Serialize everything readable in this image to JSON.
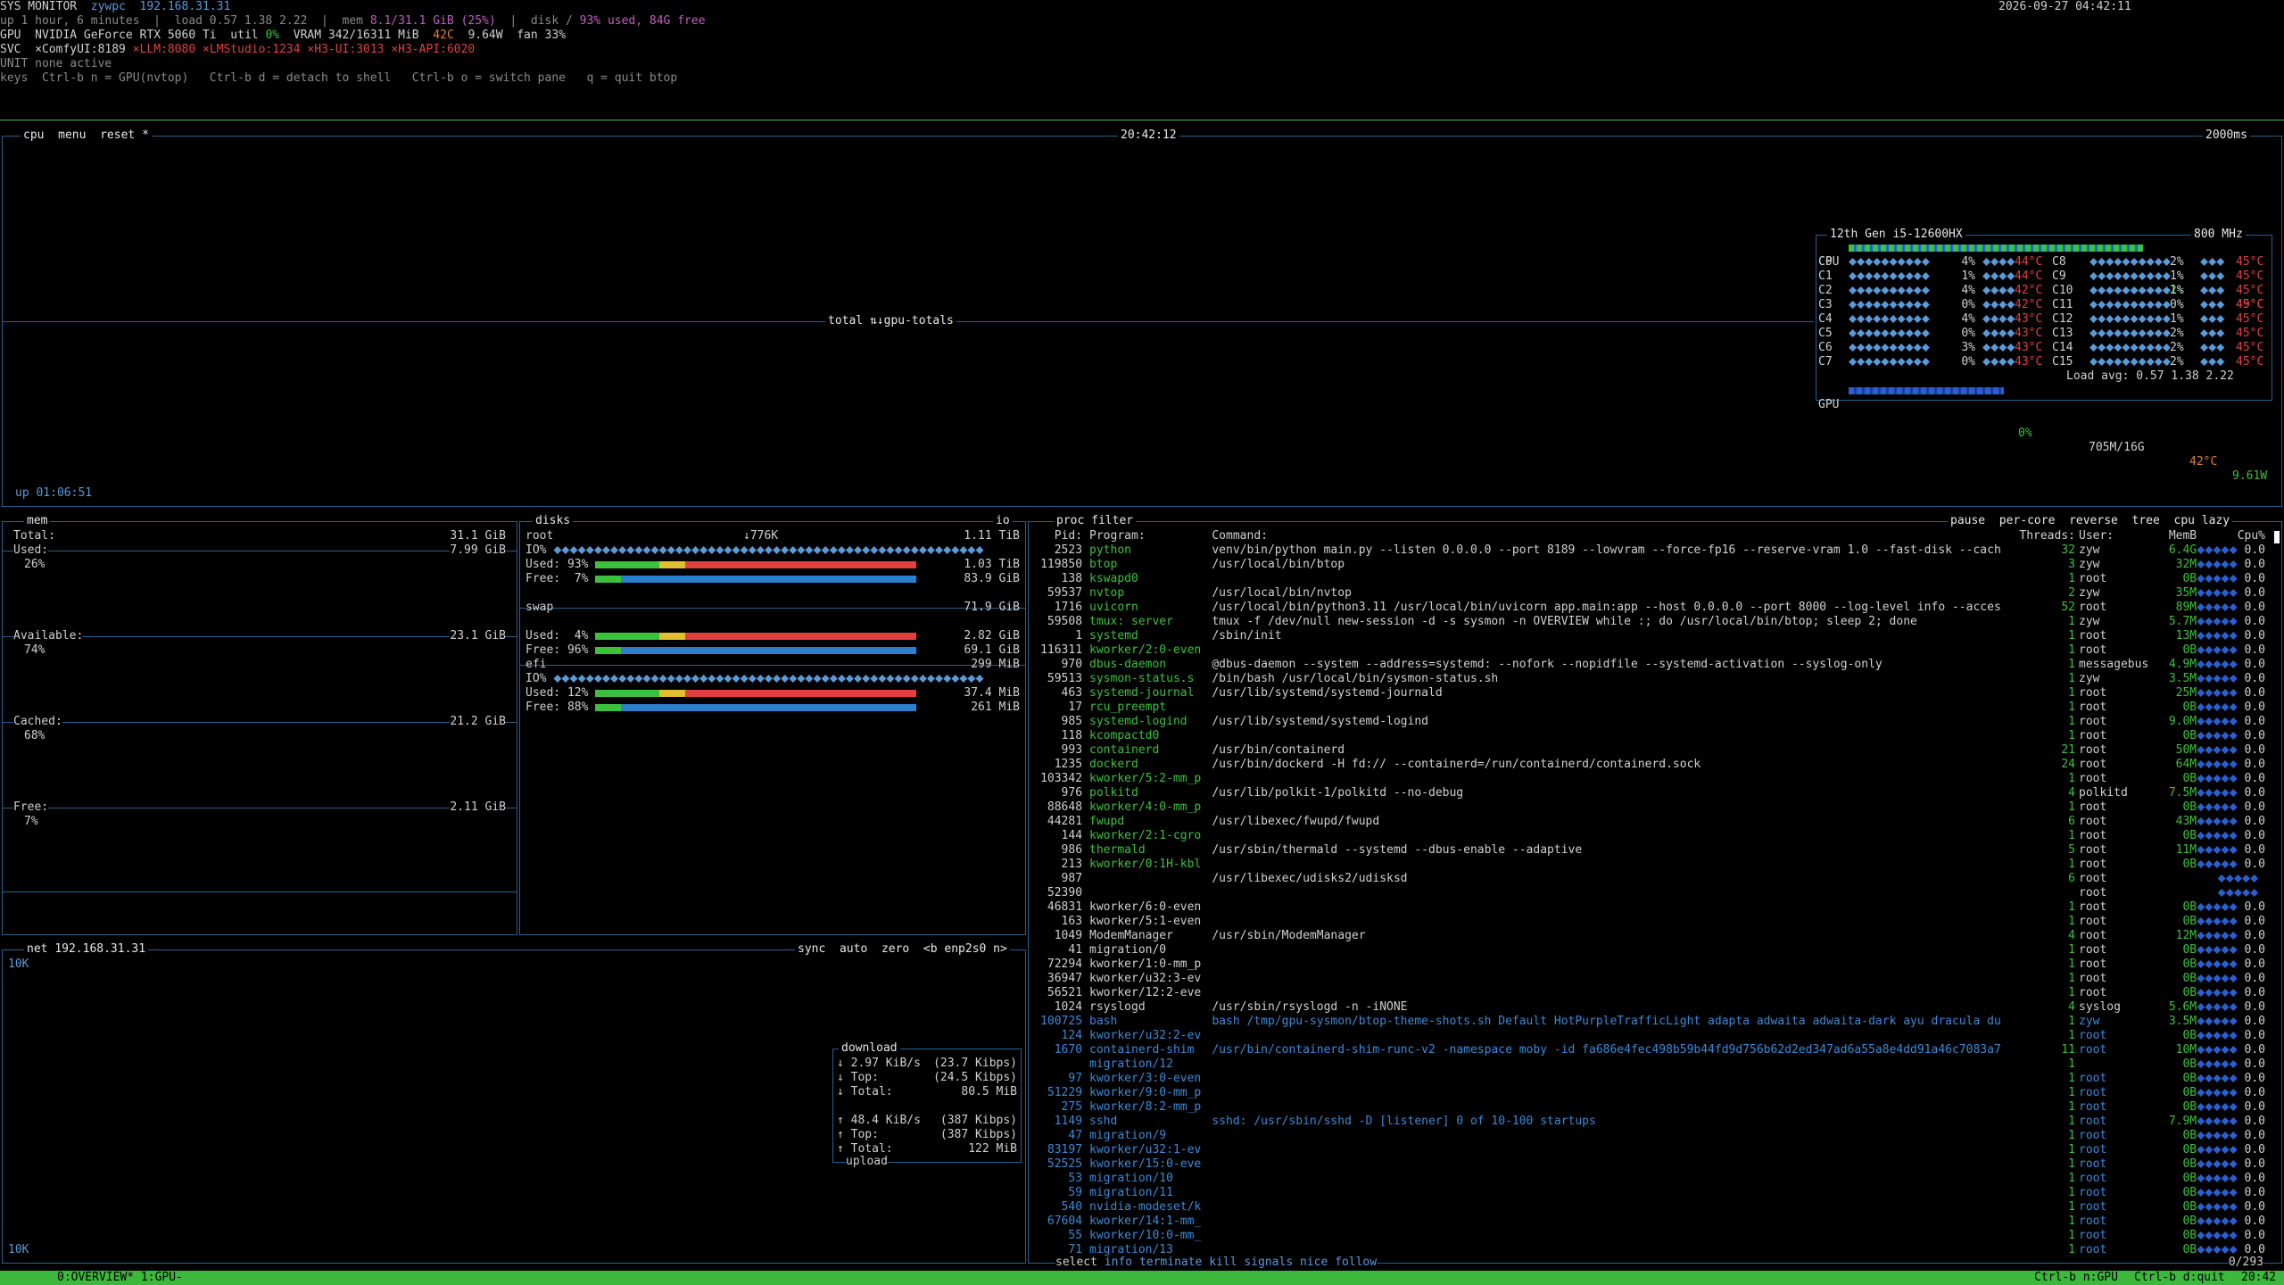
{
  "header": {
    "title": "SYS MONITOR",
    "host": "zywpc",
    "ip": "192.168.31.31",
    "datetime": "2026-09-27 04:42:11",
    "line_up": "up 1 hour, 6 minutes  |  load 0.57 1.38 2.22  |  mem ",
    "mem_val": "8.1/31.1 GiB (25%)",
    "line_mid": "  |  disk / ",
    "disk_val": "93% used, 84G free",
    "gpu_label": "GPU",
    "gpu_name": "NVIDIA GeForce RTX 5060 Ti",
    "gpu_util_label": "util",
    "gpu_util": "0%",
    "gpu_vram_label": "VRAM",
    "gpu_vram": "342/16311 MiB",
    "gpu_temp": "42C",
    "gpu_power": "9.64W",
    "gpu_fan": "fan 33%",
    "svc_label": "SVC",
    "services": [
      "×ComfyUI:8189",
      "×LLM:8080",
      "×LMStudio:1234",
      "×H3-UI:3013",
      "×H3-API:6020"
    ],
    "unit_label": "UNIT",
    "unit_val": "none active",
    "keys_label": "keys",
    "keys_val": "Ctrl-b n = GPU(nvtop)   Ctrl-b d = detach to shell   Ctrl-b o = switch pane   q = quit btop"
  },
  "cpu": {
    "tab1": "cpu",
    "tab2": "menu",
    "tab3": "reset *",
    "clock": "20:42:12",
    "interval": "2000ms",
    "graph_label": "total ⇅↓gpu-totals",
    "uptime": "up 01:06:51",
    "model": "12th Gen i5-12600HX",
    "freq": "800 MHz",
    "total_label": "CPU",
    "total_pct": "2%",
    "total_temp": "49°C",
    "cores": [
      {
        "a": "C0",
        "ap": "4%",
        "at": "44°C",
        "b": "C8",
        "bp": "2%",
        "bt": "45°C"
      },
      {
        "a": "C1",
        "ap": "1%",
        "at": "44°C",
        "b": "C9",
        "bp": "1%",
        "bt": "45°C"
      },
      {
        "a": "C2",
        "ap": "4%",
        "at": "42°C",
        "b": "C10",
        "bp": "1%",
        "bt": "45°C"
      },
      {
        "a": "C3",
        "ap": "0%",
        "at": "42°C",
        "b": "C11",
        "bp": "0%",
        "bt": "45°C"
      },
      {
        "a": "C4",
        "ap": "4%",
        "at": "43°C",
        "b": "C12",
        "bp": "1%",
        "bt": "45°C"
      },
      {
        "a": "C5",
        "ap": "0%",
        "at": "43°C",
        "b": "C13",
        "bp": "2%",
        "bt": "45°C"
      },
      {
        "a": "C6",
        "ap": "3%",
        "at": "43°C",
        "b": "C14",
        "bp": "2%",
        "bt": "45°C"
      },
      {
        "a": "C7",
        "ap": "0%",
        "at": "43°C",
        "b": "C15",
        "bp": "2%",
        "bt": "45°C"
      }
    ],
    "load_avg": "Load avg: 0.57 1.38 2.22",
    "gpu_label": "GPU",
    "gpu_pct": "0%",
    "gpu_mem": "705M/16G",
    "gpu_temp": "42°C",
    "gpu_power": "9.61W"
  },
  "mem": {
    "title": "mem",
    "total_label": "Total:",
    "total": "31.1 GiB",
    "used_label": "Used:",
    "used": "7.99 GiB",
    "used_pct": "26%",
    "avail_label": "Available:",
    "avail": "23.1 GiB",
    "avail_pct": "74%",
    "cached_label": "Cached:",
    "cached": "21.2 GiB",
    "cached_pct": "68%",
    "free_label": "Free:",
    "free": "2.11 GiB",
    "free_pct": "7%"
  },
  "disks": {
    "title": "disks",
    "io_label": "io",
    "speed": "↓776K",
    "items": [
      {
        "name": "root",
        "size": "1.11 TiB",
        "io": "IO%",
        "used_label": "Used: 93%",
        "used": "1.03 TiB",
        "free_label": "Free:  7%",
        "free": "83.9 GiB",
        "used_frac": 0.93,
        "free_frac": 0.07
      },
      {
        "name": "swap",
        "size": "71.9 GiB",
        "io": "",
        "used_label": "Used:  4%",
        "used": "2.82 GiB",
        "free_label": "Free: 96%",
        "free": "69.1 GiB",
        "used_frac": 0.04,
        "free_frac": 0.96
      },
      {
        "name": "efi",
        "size": "299 MiB",
        "io": "IO%",
        "used_label": "Used: 12%",
        "used": "37.4 MiB",
        "free_label": "Free: 88%",
        "free": "261 MiB",
        "used_frac": 0.12,
        "free_frac": 0.88
      }
    ]
  },
  "net": {
    "title": "net",
    "ip": "192.168.31.31",
    "sync": "sync",
    "auto": "auto",
    "zero": "zero",
    "iface": "<b enp2s0 n>",
    "scale_top": "10K",
    "scale_bot": "10K",
    "download_label": "download",
    "dl_rate": "2.97 KiB/s",
    "dl_rate_b": "(23.7 Kibps)",
    "dl_top_label": "Top:",
    "dl_top": "(24.5 Kibps)",
    "dl_total_label": "Total:",
    "dl_total": "80.5 MiB",
    "ul_rate": "48.4 KiB/s",
    "ul_rate_b": "(387 Kibps)",
    "ul_top_label": "Top:",
    "ul_top": "(387 Kibps)",
    "ul_total_label": "Total:",
    "ul_total": "122 MiB",
    "upload_label": "upload"
  },
  "proc": {
    "title": "proc",
    "filter": "filter",
    "opts": [
      "pause",
      "per-core",
      "reverse",
      "tree",
      "cpu lazy"
    ],
    "headers": {
      "pid": "Pid:",
      "prog": "Program:",
      "cmd": "Command:",
      "threads": "Threads:",
      "user": "User:",
      "mem": "MemB",
      "cpu": "Cpu%"
    },
    "rows": [
      {
        "pid": "2523",
        "prog": "python",
        "cmd": "venv/bin/python main.py --listen 0.0.0.0 --port 8189 --lowvram --force-fp16 --reserve-vram 1.0 --fast-disk --cach",
        "th": "32",
        "user": "zyw",
        "mem": "6.4G",
        "cpu": "0.0",
        "pc": "g"
      },
      {
        "pid": "119850",
        "prog": "btop",
        "cmd": "/usr/local/bin/btop",
        "th": "3",
        "user": "zyw",
        "mem": "32M",
        "cpu": "0.0",
        "pc": "g"
      },
      {
        "pid": "138",
        "prog": "kswapd0",
        "cmd": "",
        "th": "1",
        "user": "root",
        "mem": "0B",
        "cpu": "0.0",
        "pc": "g"
      },
      {
        "pid": "59537",
        "prog": "nvtop",
        "cmd": "/usr/local/bin/nvtop",
        "th": "2",
        "user": "zyw",
        "mem": "35M",
        "cpu": "0.0",
        "pc": "g"
      },
      {
        "pid": "1716",
        "prog": "uvicorn",
        "cmd": "/usr/local/bin/python3.11 /usr/local/bin/uvicorn app.main:app --host 0.0.0.0 --port 8000 --log-level info --acces",
        "th": "52",
        "user": "root",
        "mem": "89M",
        "cpu": "0.0",
        "pc": "g"
      },
      {
        "pid": "59508",
        "prog": "tmux: server",
        "cmd": "tmux -f /dev/null new-session -d -s sysmon -n OVERVIEW while :; do /usr/local/bin/btop; sleep 2; done",
        "th": "1",
        "user": "zyw",
        "mem": "5.7M",
        "cpu": "0.0",
        "pc": "g"
      },
      {
        "pid": "1",
        "prog": "systemd",
        "cmd": "/sbin/init",
        "th": "1",
        "user": "root",
        "mem": "13M",
        "cpu": "0.0",
        "pc": "g"
      },
      {
        "pid": "116311",
        "prog": "kworker/2:0-even",
        "cmd": "",
        "th": "1",
        "user": "root",
        "mem": "0B",
        "cpu": "0.0",
        "pc": "g"
      },
      {
        "pid": "970",
        "prog": "dbus-daemon",
        "cmd": "@dbus-daemon --system --address=systemd: --nofork --nopidfile --systemd-activation --syslog-only",
        "th": "1",
        "user": "messagebus",
        "mem": "4.9M",
        "cpu": "0.0",
        "pc": "g"
      },
      {
        "pid": "59513",
        "prog": "sysmon-status.s",
        "cmd": "/bin/bash /usr/local/bin/sysmon-status.sh",
        "th": "1",
        "user": "zyw",
        "mem": "3.5M",
        "cpu": "0.0",
        "pc": "g"
      },
      {
        "pid": "463",
        "prog": "systemd-journal",
        "cmd": "/usr/lib/systemd/systemd-journald",
        "th": "1",
        "user": "root",
        "mem": "25M",
        "cpu": "0.0",
        "pc": "g"
      },
      {
        "pid": "17",
        "prog": "rcu_preempt",
        "cmd": "",
        "th": "1",
        "user": "root",
        "mem": "0B",
        "cpu": "0.0",
        "pc": "g"
      },
      {
        "pid": "985",
        "prog": "systemd-logind",
        "cmd": "/usr/lib/systemd/systemd-logind",
        "th": "1",
        "user": "root",
        "mem": "9.0M",
        "cpu": "0.0",
        "pc": "g"
      },
      {
        "pid": "118",
        "prog": "kcompactd0",
        "cmd": "",
        "th": "1",
        "user": "root",
        "mem": "0B",
        "cpu": "0.0",
        "pc": "g"
      },
      {
        "pid": "993",
        "prog": "containerd",
        "cmd": "/usr/bin/containerd",
        "th": "21",
        "user": "root",
        "mem": "50M",
        "cpu": "0.0",
        "pc": "g"
      },
      {
        "pid": "1235",
        "prog": "dockerd",
        "cmd": "/usr/bin/dockerd -H fd:// --containerd=/run/containerd/containerd.sock",
        "th": "24",
        "user": "root",
        "mem": "64M",
        "cpu": "0.0",
        "pc": "g"
      },
      {
        "pid": "103342",
        "prog": "kworker/5:2-mm_p",
        "cmd": "",
        "th": "1",
        "user": "root",
        "mem": "0B",
        "cpu": "0.0",
        "pc": "g"
      },
      {
        "pid": "976",
        "prog": "polkitd",
        "cmd": "/usr/lib/polkit-1/polkitd --no-debug",
        "th": "4",
        "user": "polkitd",
        "mem": "7.5M",
        "cpu": "0.0",
        "pc": "g"
      },
      {
        "pid": "88648",
        "prog": "kworker/4:0-mm_p",
        "cmd": "",
        "th": "1",
        "user": "root",
        "mem": "0B",
        "cpu": "0.0",
        "pc": "g"
      },
      {
        "pid": "44281",
        "prog": "fwupd",
        "cmd": "/usr/libexec/fwupd/fwupd",
        "th": "6",
        "user": "root",
        "mem": "43M",
        "cpu": "0.0",
        "pc": "g"
      },
      {
        "pid": "144",
        "prog": "kworker/2:1-cgro",
        "cmd": "",
        "th": "1",
        "user": "root",
        "mem": "0B",
        "cpu": "0.0",
        "pc": "g"
      },
      {
        "pid": "986",
        "prog": "thermald",
        "cmd": "/usr/sbin/thermald --systemd --dbus-enable --adaptive",
        "th": "5",
        "user": "root",
        "mem": "11M",
        "cpu": "0.0",
        "pc": "g"
      },
      {
        "pid": "213",
        "prog": "kworker/0:1H-kbl",
        "cmd": "",
        "th": "1",
        "user": "root",
        "mem": "0B",
        "cpu": "0.0",
        "pc": "g"
      },
      {
        "pid": "987",
        "prog": "",
        "cmd": "/usr/libexec/udisks2/udisksd",
        "th": "6",
        "user": "root",
        "mem": "",
        "cpu": "",
        "pc": "w"
      },
      {
        "pid": "52390",
        "prog": "",
        "cmd": "",
        "th": "",
        "user": "root",
        "mem": "",
        "cpu": "",
        "pc": "w"
      },
      {
        "pid": "46831",
        "prog": "kworker/6:0-even",
        "cmd": "",
        "th": "1",
        "user": "root",
        "mem": "0B",
        "cpu": "0.0",
        "pc": "w"
      },
      {
        "pid": "163",
        "prog": "kworker/5:1-even",
        "cmd": "",
        "th": "1",
        "user": "root",
        "mem": "0B",
        "cpu": "0.0",
        "pc": "w"
      },
      {
        "pid": "1049",
        "prog": "ModemManager",
        "cmd": "/usr/sbin/ModemManager",
        "th": "4",
        "user": "root",
        "mem": "12M",
        "cpu": "0.0",
        "pc": "w"
      },
      {
        "pid": "41",
        "prog": "migration/0",
        "cmd": "",
        "th": "1",
        "user": "root",
        "mem": "0B",
        "cpu": "0.0",
        "pc": "w"
      },
      {
        "pid": "72294",
        "prog": "kworker/1:0-mm_p",
        "cmd": "",
        "th": "1",
        "user": "root",
        "mem": "0B",
        "cpu": "0.0",
        "pc": "w"
      },
      {
        "pid": "36947",
        "prog": "kworker/u32:3-ev",
        "cmd": "",
        "th": "1",
        "user": "root",
        "mem": "0B",
        "cpu": "0.0",
        "pc": "w"
      },
      {
        "pid": "56521",
        "prog": "kworker/12:2-eve",
        "cmd": "",
        "th": "1",
        "user": "root",
        "mem": "0B",
        "cpu": "0.0",
        "pc": "w"
      },
      {
        "pid": "1024",
        "prog": "rsyslogd",
        "cmd": "/usr/sbin/rsyslogd -n -iNONE",
        "th": "4",
        "user": "syslog",
        "mem": "5.6M",
        "cpu": "0.0",
        "pc": "w"
      },
      {
        "pid": "100725",
        "prog": "bash",
        "cmd": "bash /tmp/gpu-sysmon/btop-theme-shots.sh Default HotPurpleTrafficLight adapta adwaita adwaita-dark ayu dracula du",
        "th": "1",
        "user": "zyw",
        "mem": "3.5M",
        "cpu": "0.0",
        "pc": "b"
      },
      {
        "pid": "124",
        "prog": "kworker/u32:2-ev",
        "cmd": "",
        "th": "1",
        "user": "root",
        "mem": "0B",
        "cpu": "0.0",
        "pc": "b"
      },
      {
        "pid": "1670",
        "prog": "containerd-shim",
        "cmd": "/usr/bin/containerd-shim-runc-v2 -namespace moby -id fa686e4fec498b59b44fd9d756b62d2ed347ad6a55a8e4dd91a46c7083a7",
        "th": "11",
        "user": "root",
        "mem": "10M",
        "cpu": "0.0",
        "pc": "b"
      },
      {
        "pid": "",
        "prog": "migration/12",
        "cmd": "",
        "th": "1",
        "user": "",
        "mem": "0B",
        "cpu": "0.0",
        "pc": "b"
      },
      {
        "pid": "97",
        "prog": "kworker/3:0-even",
        "cmd": "",
        "th": "1",
        "user": "root",
        "mem": "0B",
        "cpu": "0.0",
        "pc": "b"
      },
      {
        "pid": "51229",
        "prog": "kworker/9:0-mm_p",
        "cmd": "",
        "th": "1",
        "user": "root",
        "mem": "0B",
        "cpu": "0.0",
        "pc": "b"
      },
      {
        "pid": "275",
        "prog": "kworker/8:2-mm_p",
        "cmd": "",
        "th": "1",
        "user": "root",
        "mem": "0B",
        "cpu": "0.0",
        "pc": "b"
      },
      {
        "pid": "1149",
        "prog": "sshd",
        "cmd": "sshd: /usr/sbin/sshd -D [listener] 0 of 10-100 startups",
        "th": "1",
        "user": "root",
        "mem": "7.9M",
        "cpu": "0.0",
        "pc": "b"
      },
      {
        "pid": "47",
        "prog": "migration/9",
        "cmd": "",
        "th": "1",
        "user": "root",
        "mem": "0B",
        "cpu": "0.0",
        "pc": "b"
      },
      {
        "pid": "83197",
        "prog": "kworker/u32:1-ev",
        "cmd": "",
        "th": "1",
        "user": "root",
        "mem": "0B",
        "cpu": "0.0",
        "pc": "b"
      },
      {
        "pid": "52525",
        "prog": "kworker/15:0-eve",
        "cmd": "",
        "th": "1",
        "user": "root",
        "mem": "0B",
        "cpu": "0.0",
        "pc": "b"
      },
      {
        "pid": "53",
        "prog": "migration/10",
        "cmd": "",
        "th": "1",
        "user": "root",
        "mem": "0B",
        "cpu": "0.0",
        "pc": "b"
      },
      {
        "pid": "59",
        "prog": "migration/11",
        "cmd": "",
        "th": "1",
        "user": "root",
        "mem": "0B",
        "cpu": "0.0",
        "pc": "b"
      },
      {
        "pid": "540",
        "prog": "nvidia-modeset/k",
        "cmd": "",
        "th": "1",
        "user": "root",
        "mem": "0B",
        "cpu": "0.0",
        "pc": "b"
      },
      {
        "pid": "67604",
        "prog": "kworker/14:1-mm_",
        "cmd": "",
        "th": "1",
        "user": "root",
        "mem": "0B",
        "cpu": "0.0",
        "pc": "b"
      },
      {
        "pid": "55",
        "prog": "kworker/10:0-mm_",
        "cmd": "",
        "th": "1",
        "user": "root",
        "mem": "0B",
        "cpu": "0.0",
        "pc": "b"
      },
      {
        "pid": "71",
        "prog": "migration/13",
        "cmd": "",
        "th": "1",
        "user": "root",
        "mem": "0B",
        "cpu": "0.0",
        "pc": "b"
      }
    ],
    "footer_select": "select",
    "footer_items": [
      "info",
      "terminate",
      "kill",
      "signals",
      "nice",
      "follow"
    ],
    "count": "0/293"
  },
  "status": {
    "left": "0:OVERVIEW* 1:GPU-",
    "right1": "Ctrl-b n:GPU",
    "right2": "Ctrl-b d:quit",
    "time": "20:42"
  }
}
